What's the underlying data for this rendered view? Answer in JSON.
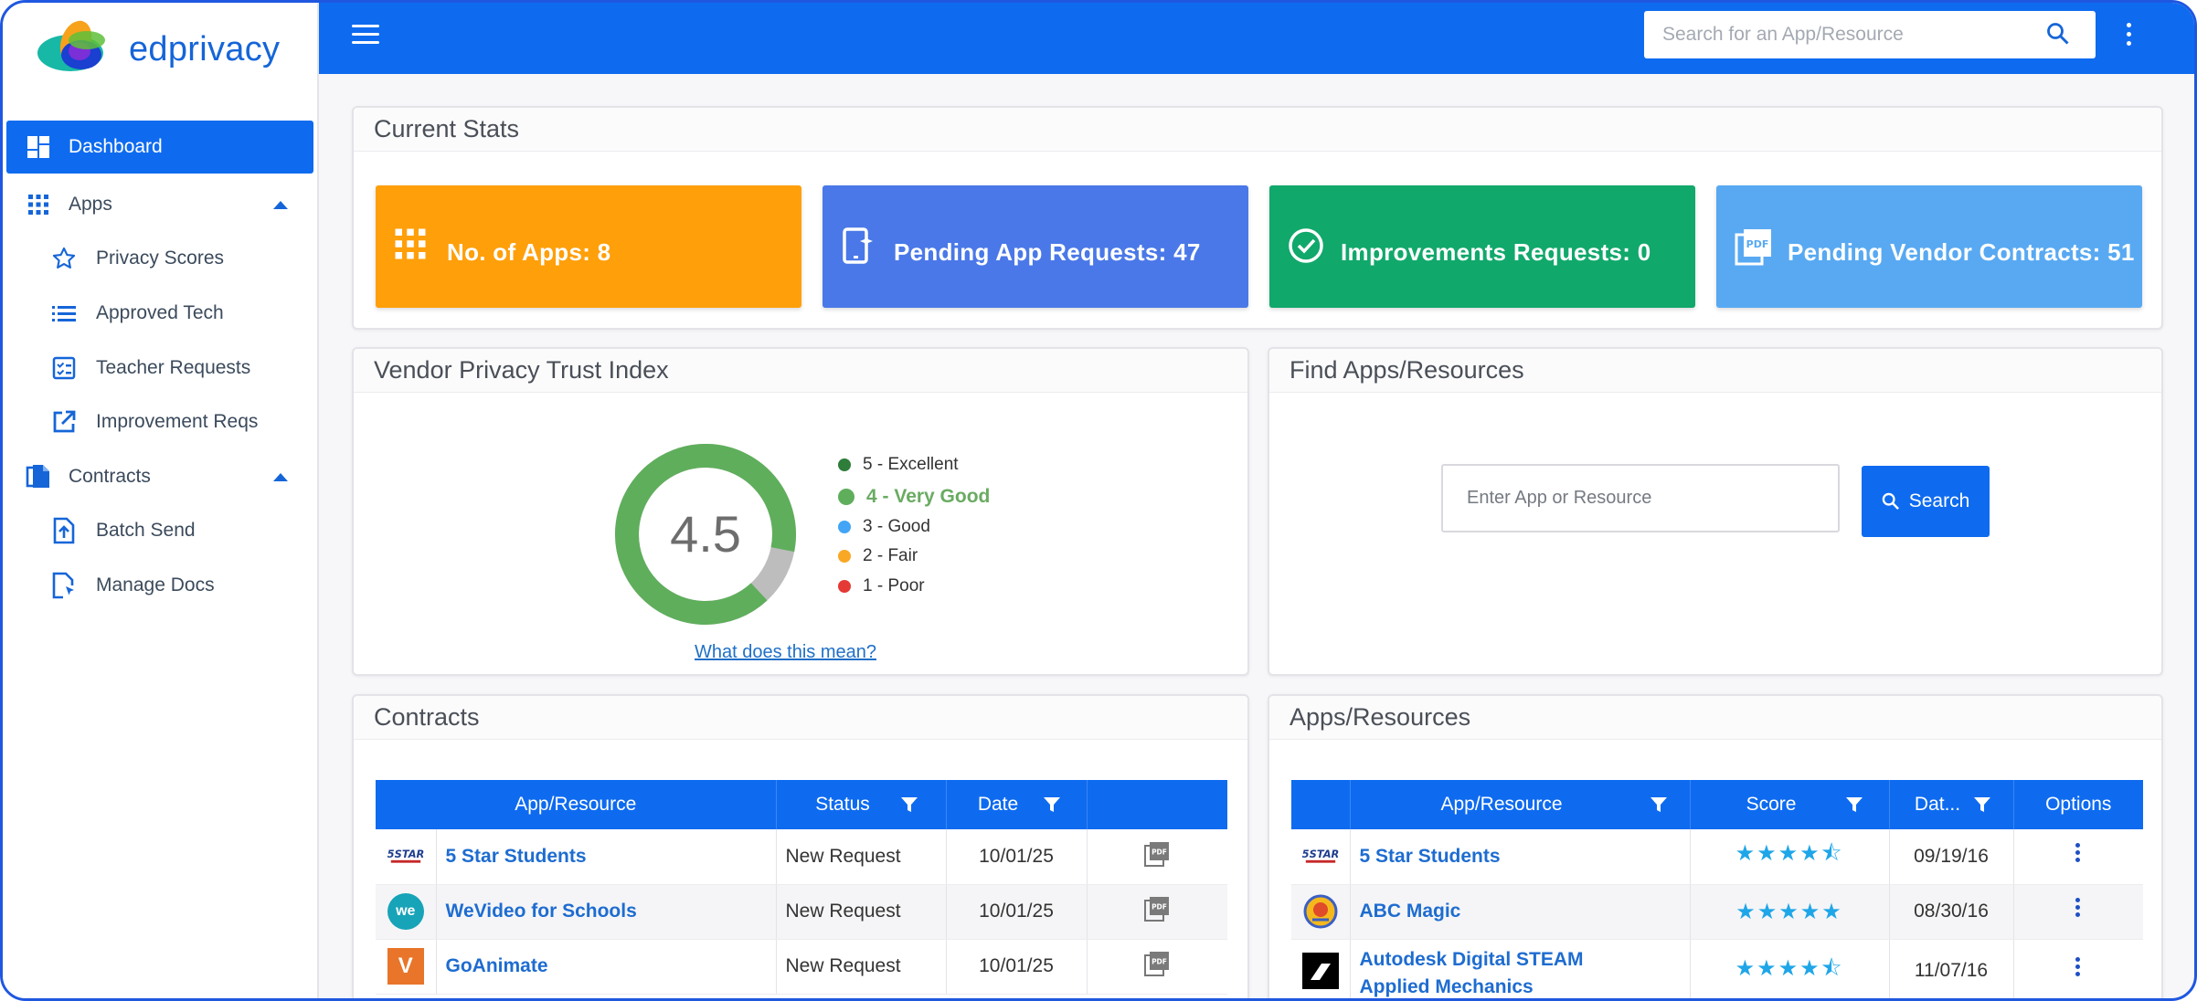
{
  "brand": {
    "name": "edprivacy"
  },
  "sidebar": {
    "items": [
      {
        "label": "Dashboard",
        "icon": "dashboard-icon"
      },
      {
        "label": "Apps",
        "icon": "apps-grid-icon"
      },
      {
        "label": "Privacy Scores",
        "icon": "star-outline-icon"
      },
      {
        "label": "Approved Tech",
        "icon": "list-icon"
      },
      {
        "label": "Teacher Requests",
        "icon": "checklist-icon"
      },
      {
        "label": "Improvement Reqs",
        "icon": "open-in-new-icon"
      },
      {
        "label": "Contracts",
        "icon": "copy-documents-icon"
      },
      {
        "label": "Batch Send",
        "icon": "upload-file-icon"
      },
      {
        "label": "Manage Docs",
        "icon": "document-cursor-icon"
      }
    ]
  },
  "topbar": {
    "search_placeholder": "Search for an App/Resource"
  },
  "current_stats": {
    "title": "Current Stats",
    "tiles": [
      {
        "label": "No. of Apps: 8",
        "color": "#ff9f0a"
      },
      {
        "label": "Pending App Requests: 47",
        "color": "#4a78e8"
      },
      {
        "label": "Improvements Requests: 0",
        "color": "#11a86b"
      },
      {
        "label": "Pending Vendor Contracts: 51",
        "color": "#58a9f2"
      }
    ]
  },
  "trust_index": {
    "title": "Vendor Privacy Trust Index",
    "score": "4.5",
    "score_fraction": 0.9,
    "legend": [
      {
        "label": "5 - Excellent",
        "color": "#2e7d3a"
      },
      {
        "label": "4 - Very Good",
        "color": "#5fae5c"
      },
      {
        "label": "3 - Good",
        "color": "#42a5f5"
      },
      {
        "label": "2 - Fair",
        "color": "#f9a825"
      },
      {
        "label": "1 - Poor",
        "color": "#e53935"
      }
    ],
    "link": "What does this mean?"
  },
  "find_apps": {
    "title": "Find Apps/Resources",
    "placeholder": "Enter App or Resource",
    "button": "Search"
  },
  "contracts": {
    "title": "Contracts",
    "columns": [
      "App/Resource",
      "Status",
      "Date"
    ],
    "rows": [
      {
        "name": "5 Star Students",
        "status": "New Request",
        "date": "10/01/25"
      },
      {
        "name": "WeVideo for Schools",
        "status": "New Request",
        "date": "10/01/25"
      },
      {
        "name": "GoAnimate",
        "status": "New Request",
        "date": "10/01/25"
      }
    ]
  },
  "apps_resources": {
    "title": "Apps/Resources",
    "columns": [
      "App/Resource",
      "Score",
      "Dat...",
      "Options"
    ],
    "rows": [
      {
        "name": "5 Star Students",
        "stars": 4.5,
        "stars_text": "★★★★⯪",
        "date": "09/19/16"
      },
      {
        "name": "ABC Magic",
        "stars": 5,
        "stars_text": "★★★★★",
        "date": "08/30/16"
      },
      {
        "name": "Autodesk Digital STEAM",
        "name2": "Applied Mechanics",
        "stars": 4.5,
        "stars_text": "★★★★⯪",
        "date": "11/07/16"
      }
    ]
  }
}
